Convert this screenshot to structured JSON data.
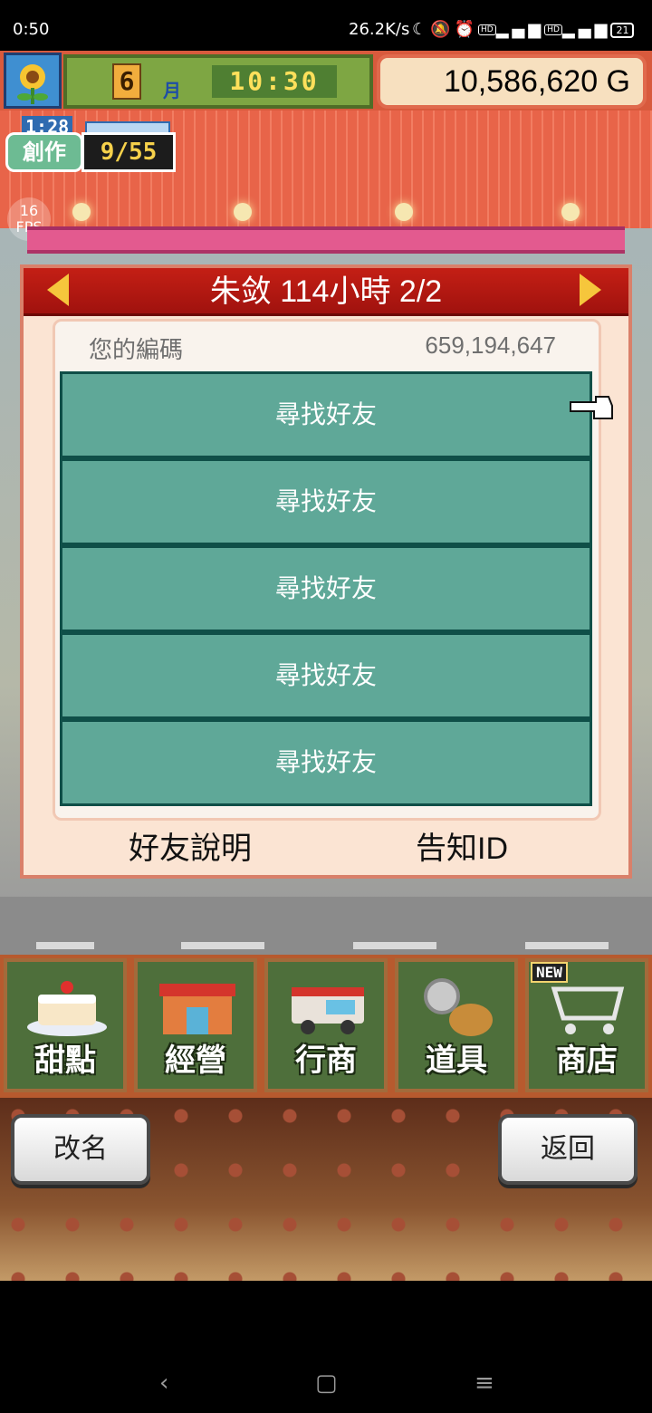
{
  "status_bar": {
    "time": "0:50",
    "net_speed": "26.2K/s",
    "battery": "21",
    "icons": [
      "moon-icon",
      "mute-icon",
      "alarm-icon",
      "hd-icon",
      "signal-4g-icon",
      "hd-icon",
      "signal-4g-icon",
      "battery-icon"
    ]
  },
  "hud": {
    "month": "6",
    "month_label": "月",
    "clock": "10:30",
    "money": "10,586,620 G",
    "create_timer": "1:28",
    "create_label": "創作",
    "create_points": "9/55",
    "fps_value": "16",
    "fps_label": "FPS"
  },
  "dialog": {
    "title": "朱敛  114小時 2/2",
    "code_label": "您的編碼",
    "code_value": "659,194,647",
    "friend_buttons": [
      "尋找好友",
      "尋找好友",
      "尋找好友",
      "尋找好友",
      "尋找好友"
    ],
    "explain_button": "好友說明",
    "notify_button": "告知ID"
  },
  "menu": {
    "items": [
      "甜點",
      "經營",
      "行商",
      "道具",
      "商店"
    ],
    "new_badge": "NEW"
  },
  "bottom": {
    "rename_button": "改名",
    "back_button": "返回"
  },
  "nav": {
    "back": "‹",
    "home": "▢",
    "menu": "≡"
  },
  "colors": {
    "friend_button": "#5fa898",
    "dialog_header": "#c41f15",
    "accent_yellow": "#f6c63c"
  }
}
